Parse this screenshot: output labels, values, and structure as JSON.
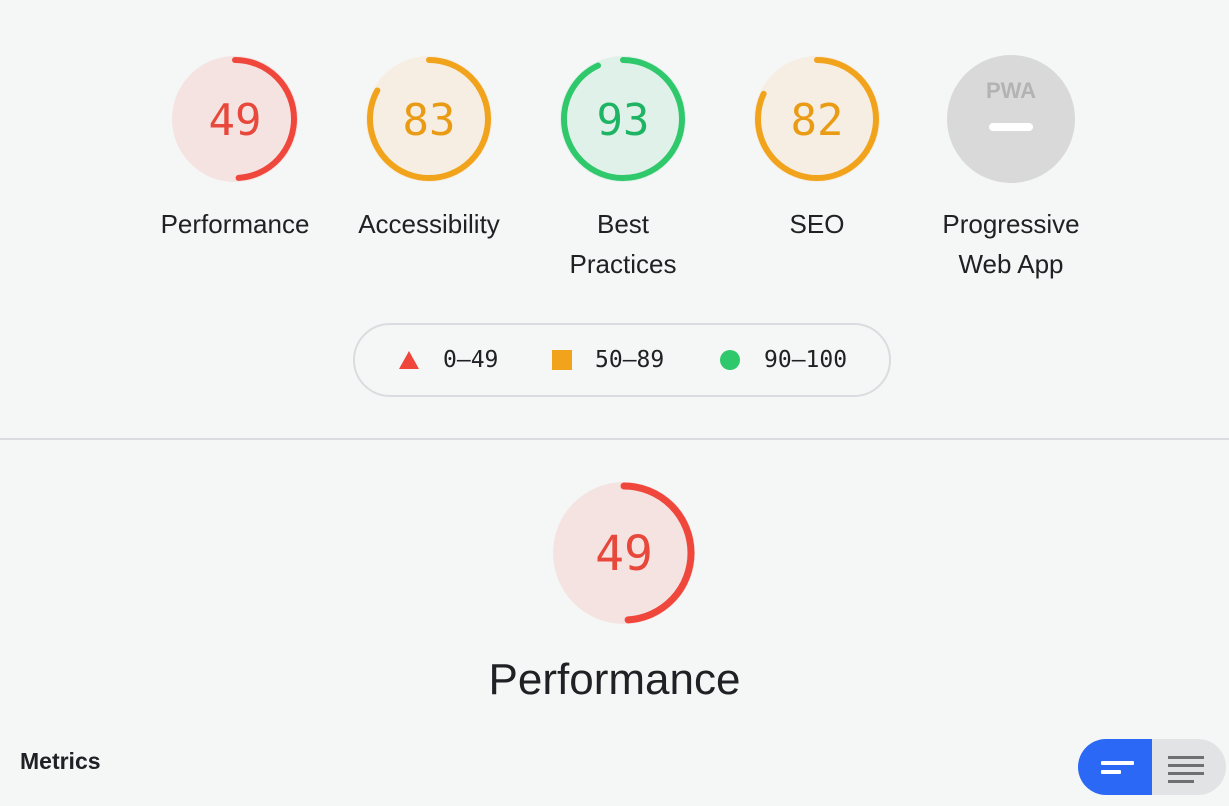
{
  "categories": [
    {
      "label_line1": "Performance",
      "label_line2": "",
      "score": "49",
      "score_fraction": 0.49,
      "rating": "fail"
    },
    {
      "label_line1": "Accessibility",
      "label_line2": "",
      "score": "83",
      "score_fraction": 0.83,
      "rating": "average"
    },
    {
      "label_line1": "Best",
      "label_line2": "Practices",
      "score": "93",
      "score_fraction": 0.93,
      "rating": "pass"
    },
    {
      "label_line1": "SEO",
      "label_line2": "",
      "score": "82",
      "score_fraction": 0.82,
      "rating": "average"
    },
    {
      "label_line1": "Progressive",
      "label_line2": "Web App",
      "score": "",
      "score_fraction": 0,
      "rating": "na",
      "badge_text": "PWA"
    }
  ],
  "legend": {
    "fail": "0–49",
    "average": "50–89",
    "pass": "90–100"
  },
  "section": {
    "title": "Performance",
    "score": "49",
    "score_fraction": 0.49
  },
  "metrics": {
    "label": "Metrics"
  },
  "colors": {
    "fail": "#f0473c",
    "fail_bg": "#f5e3e2",
    "average": "#f0a31b",
    "average_bg": "#f6ede3",
    "pass": "#2fc86b",
    "pass_bg": "#e0f1ea",
    "na": "#d9d9d9",
    "toggle_active": "#2a68f5"
  }
}
